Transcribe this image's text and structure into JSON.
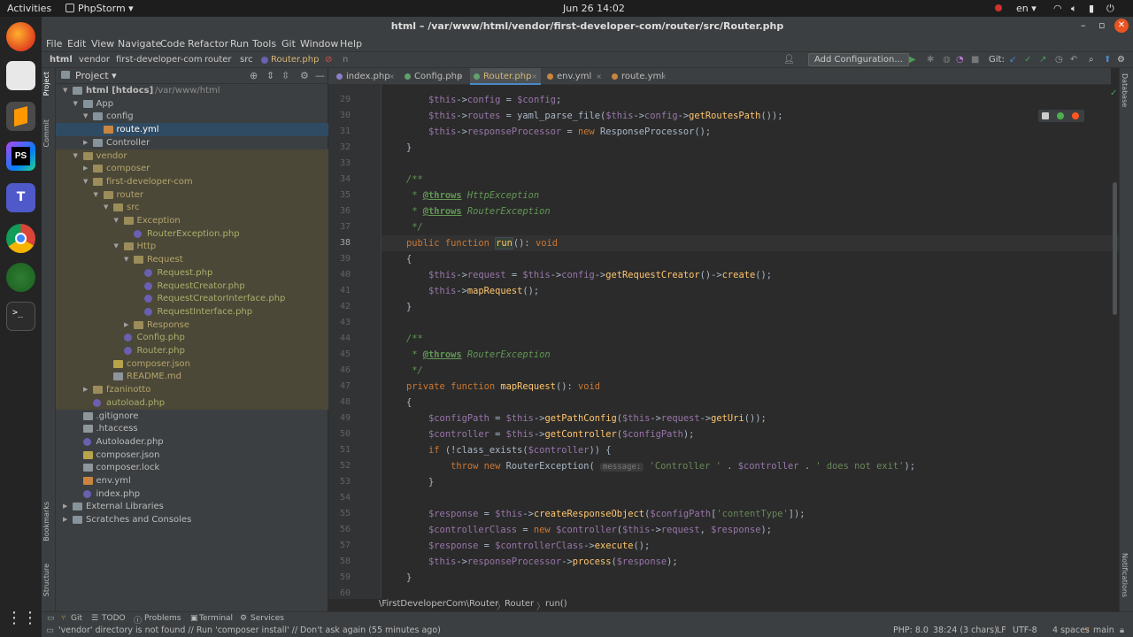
{
  "system": {
    "activities": "Activities",
    "app_menu": "PhpStorm ▾",
    "clock": "Jun 26  14:02",
    "lang": "en ▾"
  },
  "window": {
    "title": "html – /var/www/html/vendor/first-developer-com/router/src/Router.php"
  },
  "menu": [
    "File",
    "Edit",
    "View",
    "Navigate",
    "Code",
    "Refactor",
    "Run",
    "Tools",
    "Git",
    "Window",
    "Help"
  ],
  "nav": {
    "crumbs": [
      "html",
      "vendor",
      "first-developer-com",
      "router",
      "src",
      "Router.php",
      "n"
    ],
    "add_config": "Add Configuration...",
    "git_label": "Git:"
  },
  "left_tool_tabs": {
    "project": "Project",
    "commit": "Commit",
    "bookmarks": "Bookmarks",
    "structure": "Structure"
  },
  "right_tool_tabs": {
    "database": "Database",
    "notifications": "Notifications"
  },
  "project": {
    "header": "Project ▾",
    "tree": [
      {
        "label": "html [htdocs]",
        "path": "/var/www/html",
        "indent": 0,
        "arrow": "▼",
        "icon": "fold",
        "state": ""
      },
      {
        "label": "App",
        "indent": 1,
        "arrow": "▼",
        "icon": "fold",
        "state": ""
      },
      {
        "label": "config",
        "indent": 2,
        "arrow": "▼",
        "icon": "fold",
        "state": ""
      },
      {
        "label": "route.yml",
        "indent": 3,
        "arrow": "",
        "icon": "ymli",
        "state": "sel"
      },
      {
        "label": "Controller",
        "indent": 2,
        "arrow": "▶",
        "icon": "fold",
        "state": ""
      },
      {
        "label": "vendor",
        "indent": 1,
        "arrow": "▼",
        "icon": "fold",
        "state": "ex"
      },
      {
        "label": "composer",
        "indent": 2,
        "arrow": "▶",
        "icon": "fold",
        "state": "ex"
      },
      {
        "label": "first-developer-com",
        "indent": 2,
        "arrow": "▼",
        "icon": "fold",
        "state": "ex"
      },
      {
        "label": "router",
        "indent": 3,
        "arrow": "▼",
        "icon": "fold",
        "state": "ex"
      },
      {
        "label": "src",
        "indent": 4,
        "arrow": "▼",
        "icon": "fold",
        "state": "ex"
      },
      {
        "label": "Exception",
        "indent": 5,
        "arrow": "▼",
        "icon": "fold",
        "state": "ex"
      },
      {
        "label": "RouterException.php",
        "indent": 6,
        "arrow": "",
        "icon": "phpi",
        "state": "ex"
      },
      {
        "label": "Http",
        "indent": 5,
        "arrow": "▼",
        "icon": "fold",
        "state": "ex"
      },
      {
        "label": "Request",
        "indent": 6,
        "arrow": "▼",
        "icon": "fold",
        "state": "ex"
      },
      {
        "label": "Request.php",
        "indent": 7,
        "arrow": "",
        "icon": "phpi",
        "state": "ex"
      },
      {
        "label": "RequestCreator.php",
        "indent": 7,
        "arrow": "",
        "icon": "phpi",
        "state": "ex"
      },
      {
        "label": "RequestCreatorInterface.php",
        "indent": 7,
        "arrow": "",
        "icon": "phpi",
        "state": "ex"
      },
      {
        "label": "RequestInterface.php",
        "indent": 7,
        "arrow": "",
        "icon": "phpi",
        "state": "ex"
      },
      {
        "label": "Response",
        "indent": 6,
        "arrow": "▶",
        "icon": "fold",
        "state": "ex"
      },
      {
        "label": "Config.php",
        "indent": 5,
        "arrow": "",
        "icon": "phpi",
        "state": "ex"
      },
      {
        "label": "Router.php",
        "indent": 5,
        "arrow": "",
        "icon": "phpi",
        "state": "ex"
      },
      {
        "label": "composer.json",
        "indent": 4,
        "arrow": "",
        "icon": "jsoni",
        "state": "ex"
      },
      {
        "label": "README.md",
        "indent": 4,
        "arrow": "",
        "icon": "txti",
        "state": "ex"
      },
      {
        "label": "fzaninotto",
        "indent": 2,
        "arrow": "▶",
        "icon": "fold",
        "state": "ex"
      },
      {
        "label": "autoload.php",
        "indent": 2,
        "arrow": "",
        "icon": "phpi",
        "state": "ex"
      },
      {
        "label": ".gitignore",
        "indent": 1,
        "arrow": "",
        "icon": "txti",
        "state": ""
      },
      {
        "label": ".htaccess",
        "indent": 1,
        "arrow": "",
        "icon": "txti",
        "state": ""
      },
      {
        "label": "Autoloader.php",
        "indent": 1,
        "arrow": "",
        "icon": "phpi",
        "state": ""
      },
      {
        "label": "composer.json",
        "indent": 1,
        "arrow": "",
        "icon": "jsoni",
        "state": ""
      },
      {
        "label": "composer.lock",
        "indent": 1,
        "arrow": "",
        "icon": "txti",
        "state": ""
      },
      {
        "label": "env.yml",
        "indent": 1,
        "arrow": "",
        "icon": "ymli",
        "state": ""
      },
      {
        "label": "index.php",
        "indent": 1,
        "arrow": "",
        "icon": "phpi",
        "state": ""
      },
      {
        "label": "External Libraries",
        "indent": 0,
        "arrow": "▶",
        "icon": "fold",
        "state": ""
      },
      {
        "label": "Scratches and Consoles",
        "indent": 0,
        "arrow": "▶",
        "icon": "fold",
        "state": ""
      }
    ]
  },
  "tabs": [
    {
      "label": "index.php",
      "active": false
    },
    {
      "label": "Config.php",
      "active": false
    },
    {
      "label": "Router.php",
      "active": true
    },
    {
      "label": "env.yml",
      "active": false
    },
    {
      "label": "route.yml",
      "active": false
    }
  ],
  "editor": {
    "current_line": "38",
    "lines": [
      {
        "n": "29",
        "code": [
          [
            "t",
            "        "
          ],
          [
            "v",
            "$this"
          ],
          [
            "t",
            "->"
          ],
          [
            "v",
            "config"
          ],
          [
            "t",
            " = "
          ],
          [
            "v",
            "$config"
          ],
          [
            "t",
            ";"
          ]
        ]
      },
      {
        "n": "30",
        "code": [
          [
            "t",
            "        "
          ],
          [
            "v",
            "$this"
          ],
          [
            "t",
            "->"
          ],
          [
            "v",
            "routes"
          ],
          [
            "t",
            " = yaml_parse_file("
          ],
          [
            "v",
            "$this"
          ],
          [
            "t",
            "->"
          ],
          [
            "v",
            "config"
          ],
          [
            "t",
            "->"
          ],
          [
            "f",
            "getRoutesPath"
          ],
          [
            "t",
            "());"
          ]
        ]
      },
      {
        "n": "31",
        "code": [
          [
            "t",
            "        "
          ],
          [
            "v",
            "$this"
          ],
          [
            "t",
            "->"
          ],
          [
            "v",
            "responseProcessor"
          ],
          [
            "t",
            " = "
          ],
          [
            "k",
            "new "
          ],
          [
            "t",
            "ResponseProcessor();"
          ]
        ]
      },
      {
        "n": "32",
        "code": [
          [
            "t",
            "    }"
          ]
        ]
      },
      {
        "n": "33",
        "code": []
      },
      {
        "n": "34",
        "code": [
          [
            "c",
            "    /**"
          ]
        ]
      },
      {
        "n": "35",
        "code": [
          [
            "c",
            "     * "
          ],
          [
            "g",
            "@throws"
          ],
          [
            "p",
            " HttpException"
          ]
        ]
      },
      {
        "n": "36",
        "code": [
          [
            "c",
            "     * "
          ],
          [
            "g",
            "@throws"
          ],
          [
            "p",
            " RouterException"
          ]
        ]
      },
      {
        "n": "37",
        "code": [
          [
            "c",
            "     */"
          ]
        ]
      },
      {
        "n": "38",
        "code": [
          [
            "k",
            "    public function "
          ],
          [
            "h",
            "run"
          ],
          [
            "t",
            "(): "
          ],
          [
            "k",
            "void"
          ]
        ]
      },
      {
        "n": "39",
        "code": [
          [
            "t",
            "    {"
          ]
        ]
      },
      {
        "n": "40",
        "code": [
          [
            "t",
            "        "
          ],
          [
            "v",
            "$this"
          ],
          [
            "t",
            "->"
          ],
          [
            "v",
            "request"
          ],
          [
            "t",
            " = "
          ],
          [
            "v",
            "$this"
          ],
          [
            "t",
            "->"
          ],
          [
            "v",
            "config"
          ],
          [
            "t",
            "->"
          ],
          [
            "f",
            "getRequestCreator"
          ],
          [
            "t",
            "()->"
          ],
          [
            "f",
            "create"
          ],
          [
            "t",
            "();"
          ]
        ]
      },
      {
        "n": "41",
        "code": [
          [
            "t",
            "        "
          ],
          [
            "v",
            "$this"
          ],
          [
            "t",
            "->"
          ],
          [
            "f",
            "mapRequest"
          ],
          [
            "t",
            "();"
          ]
        ]
      },
      {
        "n": "42",
        "code": [
          [
            "t",
            "    }"
          ]
        ]
      },
      {
        "n": "43",
        "code": []
      },
      {
        "n": "44",
        "code": [
          [
            "c",
            "    /**"
          ]
        ]
      },
      {
        "n": "45",
        "code": [
          [
            "c",
            "     * "
          ],
          [
            "g",
            "@throws"
          ],
          [
            "p",
            " RouterException"
          ]
        ]
      },
      {
        "n": "46",
        "code": [
          [
            "c",
            "     */"
          ]
        ]
      },
      {
        "n": "47",
        "code": [
          [
            "k",
            "    private function "
          ],
          [
            "f",
            "mapRequest"
          ],
          [
            "t",
            "(): "
          ],
          [
            "k",
            "void"
          ]
        ]
      },
      {
        "n": "48",
        "code": [
          [
            "t",
            "    {"
          ]
        ]
      },
      {
        "n": "49",
        "code": [
          [
            "t",
            "        "
          ],
          [
            "v",
            "$configPath"
          ],
          [
            "t",
            " = "
          ],
          [
            "v",
            "$this"
          ],
          [
            "t",
            "->"
          ],
          [
            "f",
            "getPathConfig"
          ],
          [
            "t",
            "("
          ],
          [
            "v",
            "$this"
          ],
          [
            "t",
            "->"
          ],
          [
            "v",
            "request"
          ],
          [
            "t",
            "->"
          ],
          [
            "f",
            "getUri"
          ],
          [
            "t",
            "());"
          ]
        ]
      },
      {
        "n": "50",
        "code": [
          [
            "t",
            "        "
          ],
          [
            "v",
            "$controller"
          ],
          [
            "t",
            " = "
          ],
          [
            "v",
            "$this"
          ],
          [
            "t",
            "->"
          ],
          [
            "f",
            "getController"
          ],
          [
            "t",
            "("
          ],
          [
            "v",
            "$configPath"
          ],
          [
            "t",
            ");"
          ]
        ]
      },
      {
        "n": "51",
        "code": [
          [
            "k",
            "        if "
          ],
          [
            "t",
            "(!class_exists("
          ],
          [
            "v",
            "$controller"
          ],
          [
            "t",
            ")) {"
          ]
        ]
      },
      {
        "n": "52",
        "code": [
          [
            "k",
            "            throw new "
          ],
          [
            "t",
            "RouterException( "
          ],
          [
            "i",
            "message:"
          ],
          [
            "s",
            " 'Controller '"
          ],
          [
            "t",
            " . "
          ],
          [
            "v",
            "$controller"
          ],
          [
            "t",
            " . "
          ],
          [
            "s",
            "' does not exit'"
          ],
          [
            "t",
            ");"
          ]
        ]
      },
      {
        "n": "53",
        "code": [
          [
            "t",
            "        }"
          ]
        ]
      },
      {
        "n": "54",
        "code": []
      },
      {
        "n": "55",
        "code": [
          [
            "t",
            "        "
          ],
          [
            "v",
            "$response"
          ],
          [
            "t",
            " = "
          ],
          [
            "v",
            "$this"
          ],
          [
            "t",
            "->"
          ],
          [
            "f",
            "createResponseObject"
          ],
          [
            "t",
            "("
          ],
          [
            "v",
            "$configPath"
          ],
          [
            "t",
            "["
          ],
          [
            "s",
            "'contentType'"
          ],
          [
            "t",
            "]);"
          ]
        ]
      },
      {
        "n": "56",
        "code": [
          [
            "t",
            "        "
          ],
          [
            "v",
            "$controllerClass"
          ],
          [
            "t",
            " = "
          ],
          [
            "k",
            "new "
          ],
          [
            "v",
            "$controller"
          ],
          [
            "t",
            "("
          ],
          [
            "v",
            "$this"
          ],
          [
            "t",
            "->"
          ],
          [
            "v",
            "request"
          ],
          [
            "t",
            ", "
          ],
          [
            "v",
            "$response"
          ],
          [
            "t",
            ");"
          ]
        ]
      },
      {
        "n": "57",
        "code": [
          [
            "t",
            "        "
          ],
          [
            "v",
            "$response"
          ],
          [
            "t",
            " = "
          ],
          [
            "v",
            "$controllerClass"
          ],
          [
            "t",
            "->"
          ],
          [
            "f",
            "execute"
          ],
          [
            "t",
            "();"
          ]
        ]
      },
      {
        "n": "58",
        "code": [
          [
            "t",
            "        "
          ],
          [
            "v",
            "$this"
          ],
          [
            "t",
            "->"
          ],
          [
            "v",
            "responseProcessor"
          ],
          [
            "t",
            "->"
          ],
          [
            "f",
            "process"
          ],
          [
            "t",
            "("
          ],
          [
            "v",
            "$response"
          ],
          [
            "t",
            ");"
          ]
        ]
      },
      {
        "n": "59",
        "code": [
          [
            "t",
            "    }"
          ]
        ]
      },
      {
        "n": "60",
        "code": []
      }
    ]
  },
  "breadcrumb": [
    "\\FirstDeveloperCom\\Router",
    "Router",
    "run()"
  ],
  "bottom_tools": [
    "Git",
    "TODO",
    "Problems",
    "Terminal",
    "Services"
  ],
  "status": {
    "message": "'vendor' directory is not found // Run 'composer install' // Don't ask again (55 minutes ago)",
    "php": "PHP: 8.0",
    "pos": "38:24 (3 chars)",
    "lf": "LF",
    "enc": "UTF-8",
    "indent": "4 spaces",
    "branch": "main"
  },
  "colors": {
    "accent": "#4a88c7",
    "excluded_bg": "#4b4838",
    "selected_bg": "#2f4b63",
    "keyword": "#cc7832",
    "variable": "#9876aa",
    "function": "#ffc66d",
    "string": "#6a8759",
    "doc": "#629755"
  }
}
